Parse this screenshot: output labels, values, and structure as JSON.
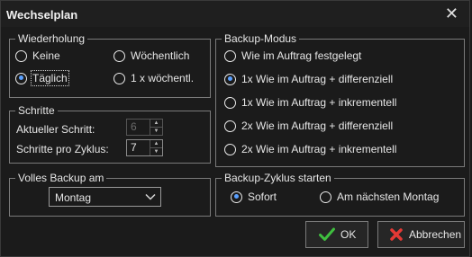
{
  "window": {
    "title": "Wechselplan",
    "close_glyph": "✕"
  },
  "repetition": {
    "title": "Wiederholung",
    "options": [
      {
        "label": "Keine",
        "checked": false
      },
      {
        "label": "Wöchentlich",
        "checked": false
      },
      {
        "label": "Täglich",
        "checked": true
      },
      {
        "label": "1 x wöchentl.",
        "checked": false
      }
    ]
  },
  "steps": {
    "title": "Schritte",
    "current_label": "Aktueller Schritt:",
    "current_value": "6",
    "per_cycle_label": "Schritte pro Zyklus:",
    "per_cycle_value": "7"
  },
  "full_backup": {
    "title": "Volles Backup am",
    "selected": "Montag"
  },
  "backup_mode": {
    "title": "Backup-Modus",
    "options": [
      {
        "label": "Wie im Auftrag festgelegt",
        "checked": false
      },
      {
        "label": "1x Wie im Auftrag + differenziell",
        "checked": true
      },
      {
        "label": "1x Wie im Auftrag + inkrementell",
        "checked": false
      },
      {
        "label": "2x Wie im Auftrag + differenziell",
        "checked": false
      },
      {
        "label": "2x Wie im Auftrag + inkrementell",
        "checked": false
      }
    ]
  },
  "cycle_start": {
    "title": "Backup-Zyklus starten",
    "options": [
      {
        "label": "Sofort",
        "checked": true
      },
      {
        "label": "Am nächsten Montag",
        "checked": false
      }
    ]
  },
  "buttons": {
    "ok": "OK",
    "cancel": "Abbrechen"
  },
  "colors": {
    "background": "#1b1b1b",
    "radio_accent": "#5aa0ff",
    "ok_icon": "#3fbf3f",
    "cancel_icon": "#e53935"
  },
  "icons": {
    "ok": "checkmark-icon",
    "cancel": "red-x-icon",
    "spin": "spin-arrows-icon",
    "dropdown": "chevron-down-icon"
  }
}
